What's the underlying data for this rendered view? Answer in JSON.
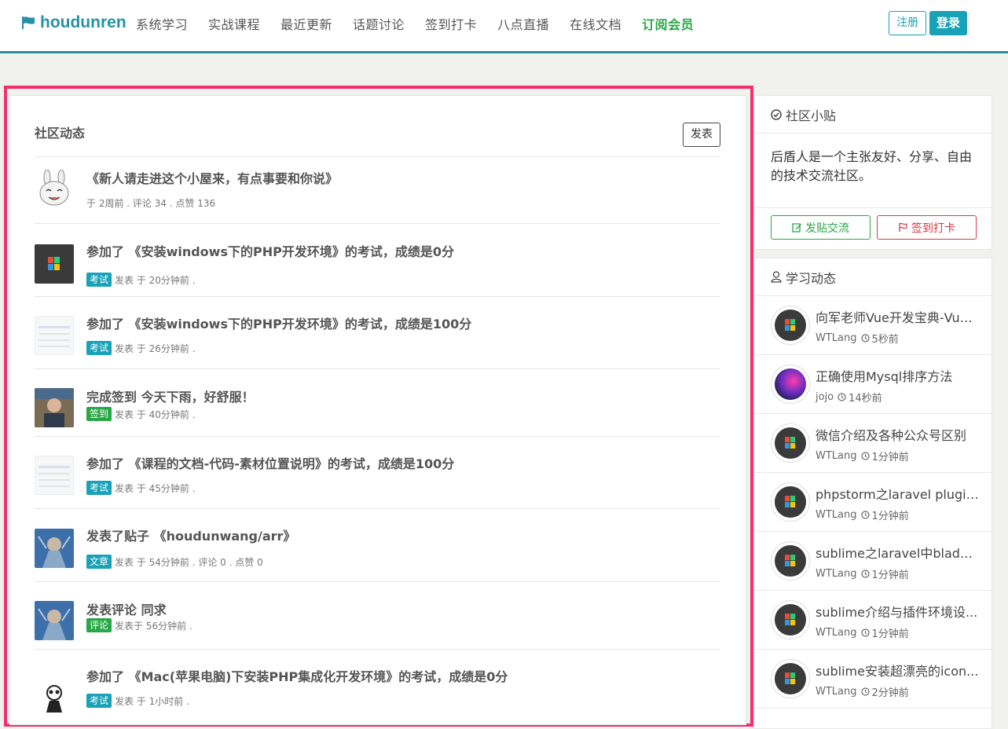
{
  "header": {
    "brand": "houdunren",
    "nav": [
      "系统学习",
      "实战课程",
      "最近更新",
      "话题讨论",
      "签到打卡",
      "八点直播",
      "在线文档",
      "订阅会员"
    ],
    "register": "注册",
    "login": "登录"
  },
  "feed": {
    "title": "社区动态",
    "post_button": "发表",
    "items": [
      {
        "title": "《新人请走进这个小屋来，有点事要和你说》",
        "tag": "",
        "meta": "于 2周前 . 评论 34 . 点赞 136"
      },
      {
        "title": "参加了 《安装windows下的PHP开发环境》的考试，成绩是0分",
        "tag": "考试",
        "meta": "发表 于 20分钟前 ."
      },
      {
        "title": "参加了 《安装windows下的PHP开发环境》的考试，成绩是100分",
        "tag": "考试",
        "meta": "发表 于 26分钟前 ."
      },
      {
        "title": "完成签到 今天下雨，好舒服！",
        "tag": "签到",
        "meta": "发表 于 40分钟前 ."
      },
      {
        "title": "参加了 《课程的文档-代码-素材位置说明》的考试，成绩是100分",
        "tag": "考试",
        "meta": "发表 于 45分钟前 ."
      },
      {
        "title": "发表了贴子 《houdunwang/arr》",
        "tag": "文章",
        "meta": "发表 于 54分钟前 . 评论 0 . 点赞 0"
      },
      {
        "title": "发表评论 同求",
        "tag": "评论",
        "meta": "发表于 56分钟前 ."
      },
      {
        "title": "参加了 《Mac(苹果电脑)下安装PHP集成化开发环境》的考试，成绩是0分",
        "tag": "考试",
        "meta": "发表 于 1小时前 ."
      }
    ]
  },
  "tips": {
    "title": "社区小贴",
    "text": "后盾人是一个主张友好、分享、自由的技术交流社区。",
    "chat_button": "发贴交流",
    "sign_button": "签到打卡"
  },
  "study": {
    "title": "学习动态",
    "items": [
      {
        "title": "向军老师Vue开发宝典-Vue...",
        "user": "WTLang",
        "time": "5秒前"
      },
      {
        "title": "正确使用Mysql排序方法",
        "user": "jojo",
        "time": "14秒前"
      },
      {
        "title": "微信介绍及各种公众号区别",
        "user": "WTLang",
        "time": "1分钟前"
      },
      {
        "title": "phpstorm之laravel plugin...",
        "user": "WTLang",
        "time": "1分钟前"
      },
      {
        "title": "sublime之laravel中blade...",
        "user": "WTLang",
        "time": "1分钟前"
      },
      {
        "title": "sublime介绍与插件环境设...",
        "user": "WTLang",
        "time": "1分钟前"
      },
      {
        "title": "sublime安装超漂亮的icon...",
        "user": "WTLang",
        "time": "2分钟前"
      }
    ]
  },
  "colors": {
    "brand": "#2691a4",
    "accent": "#17a2b8",
    "highlight": "#f0306e",
    "success": "#28a745",
    "danger": "#dc3545"
  }
}
